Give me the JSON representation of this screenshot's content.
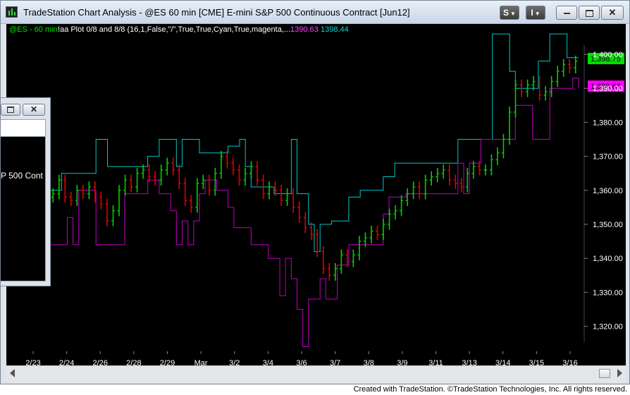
{
  "window": {
    "title": "TradeStation Chart Analysis - @ES 60 min [CME] E-mini S&P 500 Continuous Contract [Jun12]"
  },
  "toolbar": {
    "style_label": "S",
    "indicator_label": "I"
  },
  "popup": {
    "text": "P 500 Cont"
  },
  "footer": {
    "credit": "Created with TradeStation. ©TradeStation Technologies, Inc. All rights reserved."
  },
  "chart_data": {
    "type": "line",
    "symbol_label": "@ES - 60 min",
    "study_label": "!aa Plot 0/8 and 8/8 (16,1,False,\"/\",True,True,Cyan,True,magenta,...",
    "study_values": [
      "1390.63",
      "1398.44"
    ],
    "y_ticks": [
      "1,400.00",
      "1,390.00",
      "1,380.00",
      "1,370.00",
      "1,360.00",
      "1,350.00",
      "1,340.00",
      "1,330.00",
      "1,320.00"
    ],
    "ylim": [
      1313,
      1407
    ],
    "x_labels": [
      "2/23",
      "2/24",
      "2/26",
      "2/28",
      "2/29",
      "Mar",
      "3/2",
      "3/4",
      "3/6",
      "3/7",
      "3/8",
      "3/9",
      "3/11",
      "3/13",
      "3/14",
      "3/15",
      "3/16"
    ],
    "price_tags": [
      {
        "value": 1398.75,
        "label": "1,398.75",
        "color": "#00e000",
        "text_color": "#000000"
      },
      {
        "value": 1390.63,
        "label": "1,390.63",
        "color": "#ff00ff",
        "text_color": "#000000"
      }
    ],
    "colors": {
      "up": "#00d000",
      "down": "#e00000",
      "top_band": "#00c8c8",
      "bottom_band": "#c000c0",
      "background": "#000000",
      "axis_text": "#ffffff"
    },
    "price_close": [
      1359,
      1363,
      1358,
      1357,
      1360,
      1359,
      1361,
      1358,
      1356,
      1351,
      1354,
      1360,
      1363,
      1361,
      1365,
      1366,
      1364,
      1363,
      1366,
      1368,
      1366,
      1362,
      1357,
      1355,
      1362,
      1363,
      1360,
      1365,
      1370,
      1368,
      1366,
      1363,
      1365,
      1367,
      1363,
      1359,
      1361,
      1360,
      1357,
      1359,
      1355,
      1352,
      1349,
      1347,
      1342,
      1337,
      1335,
      1337,
      1341,
      1339,
      1341,
      1345,
      1346,
      1348,
      1347,
      1350,
      1353,
      1354,
      1357,
      1359,
      1361,
      1359,
      1363,
      1364,
      1365,
      1366,
      1363,
      1362,
      1361,
      1365,
      1367,
      1366,
      1366,
      1369,
      1371,
      1375,
      1383,
      1391,
      1389,
      1391,
      1392,
      1388,
      1389,
      1392,
      1395,
      1397,
      1396,
      1398
    ],
    "top_band": [
      {
        "x": 0,
        "y": 1360
      },
      {
        "x": 2,
        "y": 1360
      },
      {
        "x": 2,
        "y": 1365
      },
      {
        "x": 8,
        "y": 1365
      },
      {
        "x": 8,
        "y": 1375
      },
      {
        "x": 10,
        "y": 1375
      },
      {
        "x": 10,
        "y": 1367
      },
      {
        "x": 17,
        "y": 1367
      },
      {
        "x": 17,
        "y": 1370
      },
      {
        "x": 19,
        "y": 1370
      },
      {
        "x": 19,
        "y": 1375
      },
      {
        "x": 22,
        "y": 1375
      },
      {
        "x": 22,
        "y": 1367
      },
      {
        "x": 23,
        "y": 1367
      },
      {
        "x": 23,
        "y": 1375
      },
      {
        "x": 26,
        "y": 1375
      },
      {
        "x": 26,
        "y": 1371
      },
      {
        "x": 31,
        "y": 1371
      },
      {
        "x": 31,
        "y": 1373
      },
      {
        "x": 33,
        "y": 1373
      },
      {
        "x": 33,
        "y": 1375
      },
      {
        "x": 34,
        "y": 1375
      },
      {
        "x": 34,
        "y": 1367
      },
      {
        "x": 35,
        "y": 1367
      },
      {
        "x": 35,
        "y": 1361
      },
      {
        "x": 39,
        "y": 1361
      },
      {
        "x": 39,
        "y": 1359
      },
      {
        "x": 42,
        "y": 1359
      },
      {
        "x": 42,
        "y": 1375
      },
      {
        "x": 43,
        "y": 1375
      },
      {
        "x": 43,
        "y": 1359
      },
      {
        "x": 45,
        "y": 1359
      },
      {
        "x": 45,
        "y": 1350
      },
      {
        "x": 46,
        "y": 1350
      },
      {
        "x": 46,
        "y": 1342
      },
      {
        "x": 47,
        "y": 1342
      },
      {
        "x": 47,
        "y": 1350
      },
      {
        "x": 49,
        "y": 1350
      },
      {
        "x": 49,
        "y": 1351
      },
      {
        "x": 52,
        "y": 1351
      },
      {
        "x": 52,
        "y": 1358
      },
      {
        "x": 54,
        "y": 1358
      },
      {
        "x": 54,
        "y": 1360
      },
      {
        "x": 58,
        "y": 1360
      },
      {
        "x": 58,
        "y": 1364
      },
      {
        "x": 60,
        "y": 1364
      },
      {
        "x": 60,
        "y": 1368
      },
      {
        "x": 71,
        "y": 1368
      },
      {
        "x": 71,
        "y": 1375
      },
      {
        "x": 77,
        "y": 1375
      },
      {
        "x": 77,
        "y": 1406
      },
      {
        "x": 80,
        "y": 1406
      },
      {
        "x": 80,
        "y": 1395
      },
      {
        "x": 81,
        "y": 1395
      },
      {
        "x": 81,
        "y": 1390
      },
      {
        "x": 85,
        "y": 1390
      },
      {
        "x": 85,
        "y": 1398
      },
      {
        "x": 87,
        "y": 1398
      },
      {
        "x": 87,
        "y": 1406
      },
      {
        "x": 90,
        "y": 1406
      },
      {
        "x": 90,
        "y": 1399
      },
      {
        "x": 92,
        "y": 1399
      }
    ],
    "bottom_band": [
      {
        "x": 0,
        "y": 1344
      },
      {
        "x": 3,
        "y": 1344
      },
      {
        "x": 3,
        "y": 1352
      },
      {
        "x": 4,
        "y": 1352
      },
      {
        "x": 4,
        "y": 1344
      },
      {
        "x": 5,
        "y": 1344
      },
      {
        "x": 5,
        "y": 1360
      },
      {
        "x": 8,
        "y": 1360
      },
      {
        "x": 8,
        "y": 1344
      },
      {
        "x": 13,
        "y": 1344
      },
      {
        "x": 13,
        "y": 1359
      },
      {
        "x": 17,
        "y": 1359
      },
      {
        "x": 17,
        "y": 1363
      },
      {
        "x": 19,
        "y": 1363
      },
      {
        "x": 19,
        "y": 1359
      },
      {
        "x": 21,
        "y": 1359
      },
      {
        "x": 21,
        "y": 1354
      },
      {
        "x": 22,
        "y": 1354
      },
      {
        "x": 22,
        "y": 1344
      },
      {
        "x": 23,
        "y": 1344
      },
      {
        "x": 23,
        "y": 1351
      },
      {
        "x": 24,
        "y": 1351
      },
      {
        "x": 24,
        "y": 1344
      },
      {
        "x": 25,
        "y": 1344
      },
      {
        "x": 25,
        "y": 1351
      },
      {
        "x": 26,
        "y": 1351
      },
      {
        "x": 26,
        "y": 1359
      },
      {
        "x": 27,
        "y": 1359
      },
      {
        "x": 27,
        "y": 1363
      },
      {
        "x": 29,
        "y": 1363
      },
      {
        "x": 29,
        "y": 1360
      },
      {
        "x": 31,
        "y": 1360
      },
      {
        "x": 31,
        "y": 1355
      },
      {
        "x": 32,
        "y": 1355
      },
      {
        "x": 32,
        "y": 1349
      },
      {
        "x": 35,
        "y": 1349
      },
      {
        "x": 35,
        "y": 1344
      },
      {
        "x": 38,
        "y": 1344
      },
      {
        "x": 38,
        "y": 1340
      },
      {
        "x": 40,
        "y": 1340
      },
      {
        "x": 40,
        "y": 1329
      },
      {
        "x": 41,
        "y": 1329
      },
      {
        "x": 41,
        "y": 1340
      },
      {
        "x": 42,
        "y": 1340
      },
      {
        "x": 42,
        "y": 1334
      },
      {
        "x": 43,
        "y": 1334
      },
      {
        "x": 43,
        "y": 1325
      },
      {
        "x": 44,
        "y": 1325
      },
      {
        "x": 44,
        "y": 1314
      },
      {
        "x": 45,
        "y": 1314
      },
      {
        "x": 45,
        "y": 1328
      },
      {
        "x": 47,
        "y": 1328
      },
      {
        "x": 47,
        "y": 1334
      },
      {
        "x": 48,
        "y": 1334
      },
      {
        "x": 48,
        "y": 1328
      },
      {
        "x": 50,
        "y": 1328
      },
      {
        "x": 50,
        "y": 1338
      },
      {
        "x": 52,
        "y": 1338
      },
      {
        "x": 52,
        "y": 1344
      },
      {
        "x": 58,
        "y": 1344
      },
      {
        "x": 58,
        "y": 1353
      },
      {
        "x": 59,
        "y": 1353
      },
      {
        "x": 59,
        "y": 1358
      },
      {
        "x": 62,
        "y": 1358
      },
      {
        "x": 62,
        "y": 1359
      },
      {
        "x": 71,
        "y": 1359
      },
      {
        "x": 71,
        "y": 1368
      },
      {
        "x": 72,
        "y": 1368
      },
      {
        "x": 72,
        "y": 1359
      },
      {
        "x": 73,
        "y": 1359
      },
      {
        "x": 73,
        "y": 1368
      },
      {
        "x": 75,
        "y": 1368
      },
      {
        "x": 75,
        "y": 1375
      },
      {
        "x": 81,
        "y": 1375
      },
      {
        "x": 81,
        "y": 1385
      },
      {
        "x": 84,
        "y": 1385
      },
      {
        "x": 84,
        "y": 1375
      },
      {
        "x": 87,
        "y": 1375
      },
      {
        "x": 87,
        "y": 1390
      },
      {
        "x": 91,
        "y": 1390
      },
      {
        "x": 91,
        "y": 1393
      },
      {
        "x": 92,
        "y": 1393
      },
      {
        "x": 92,
        "y": 1390
      }
    ]
  }
}
